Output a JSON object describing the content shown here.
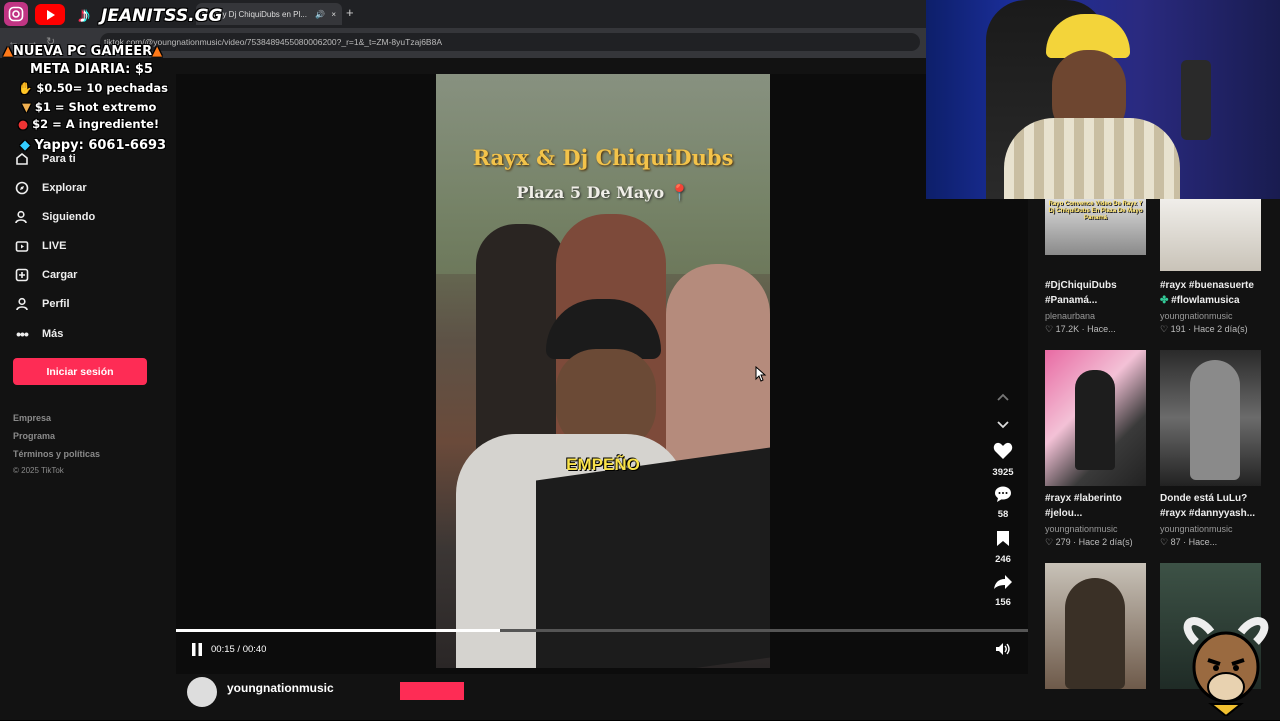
{
  "browser": {
    "tab_title": "Rayx y Dj ChiquiDubs en Pl...",
    "tab_close": "×",
    "new_tab": "+",
    "url": "tiktok.com/@youngnationmusic/video/7538489455080006200?_r=1&_t=ZM-8yuTzaj6B8A"
  },
  "stream_overlay": {
    "handle": "JEANITSS.GG",
    "line1": "NUEVA PC GAMEER",
    "line2": "META DIARIA: $5",
    "line3": "$0.50= 10 pechadas",
    "line4": "$1 = Shot extremo",
    "line5": "$2 = A ingrediente!",
    "line6": "Yappy: 6061-6693",
    "colors": {
      "youtube": "#ff0000",
      "instagram": "#c13584"
    }
  },
  "sidebar": {
    "items": [
      {
        "label": "Para ti",
        "icon": "home-icon"
      },
      {
        "label": "Explorar",
        "icon": "compass-icon"
      },
      {
        "label": "Siguiendo",
        "icon": "user-follow-icon"
      },
      {
        "label": "LIVE",
        "icon": "live-icon"
      },
      {
        "label": "Cargar",
        "icon": "upload-icon"
      },
      {
        "label": "Perfil",
        "icon": "profile-icon"
      },
      {
        "label": "Más",
        "icon": "more-icon"
      }
    ],
    "login_label": "Iniciar sesión",
    "footer": [
      "Empresa",
      "Programa",
      "Términos y políticas",
      "© 2025 TikTok"
    ]
  },
  "video": {
    "title": "Rayx & Dj ChiquiDubs",
    "subtitle": "Plaza 5 De Mayo",
    "caption": "EMPEÑO",
    "time": "00:15 / 00:40",
    "progress": 0.38,
    "author": "youngnationmusic"
  },
  "actions": {
    "likes": "3925",
    "comments": "58",
    "saves": "246",
    "shares": "156"
  },
  "recommended": [
    {
      "caption1": "#DjChiquiDubs",
      "caption2": "#Panamá...",
      "author": "plenaurbana",
      "views": "17.2K",
      "time": "Hace...",
      "thumb_text": "Rayo Convence Video De Rayx Y Dj ChiquiDubs En Plaza De Mayo Panamá"
    },
    {
      "caption1": "#rayx #buenasuerte",
      "caption2": "#flowlamusica",
      "author": "youngnationmusic",
      "views": "191",
      "time": "Hace 2 día(s)"
    },
    {
      "caption1": "#rayx #laberinto",
      "caption2": "#jelou...",
      "author": "youngnationmusic",
      "views": "279",
      "time": "Hace 2 día(s)"
    },
    {
      "caption1": "Donde está LuLu?",
      "caption2": "#rayx #dannyyash...",
      "author": "youngnationmusic",
      "views": "87",
      "time": "Hace..."
    }
  ],
  "colors": {
    "accent": "#fe2c55",
    "background": "#121212"
  }
}
